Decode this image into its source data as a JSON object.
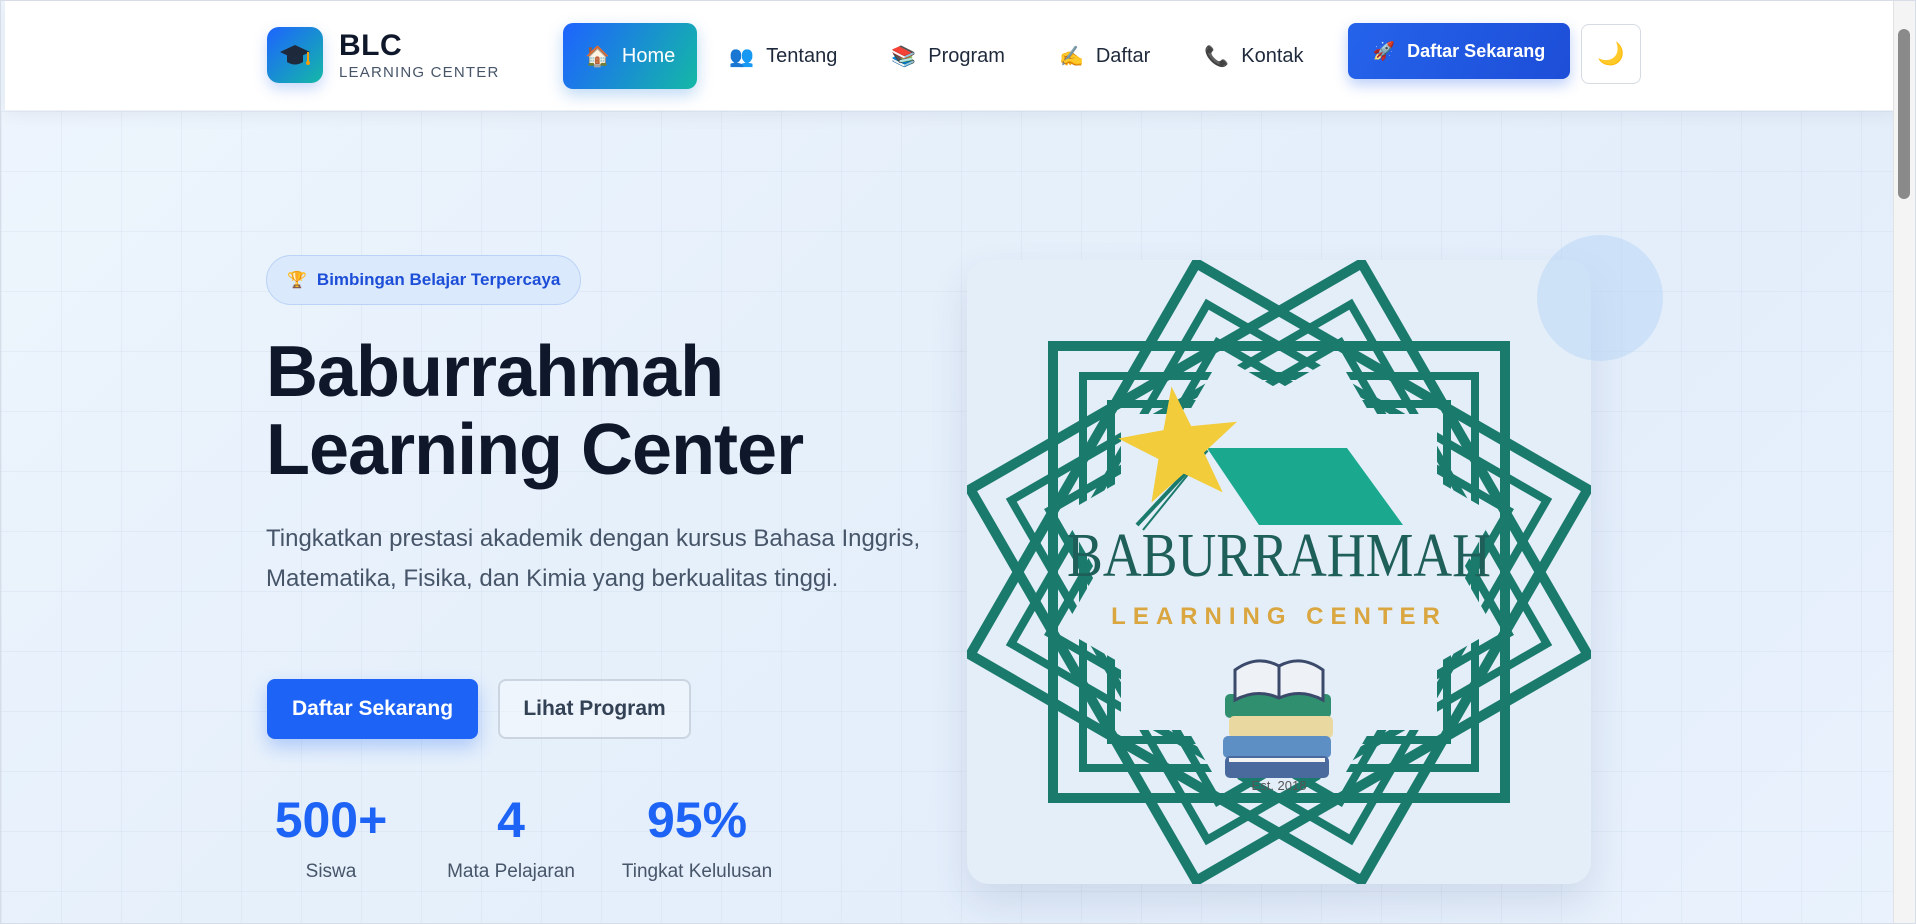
{
  "nav": {
    "brand_title": "BLC",
    "brand_subtitle": "LEARNING CENTER",
    "brand_icon": "graduation-cap-icon",
    "items": [
      {
        "label": "Home",
        "icon": "🏠",
        "icon_name": "house-icon",
        "active": true
      },
      {
        "label": "Tentang",
        "icon": "👥",
        "icon_name": "people-icon",
        "active": false
      },
      {
        "label": "Program",
        "icon": "📚",
        "icon_name": "books-icon",
        "active": false
      },
      {
        "label": "Daftar",
        "icon": "✍️",
        "icon_name": "writing-hand-icon",
        "active": false
      },
      {
        "label": "Kontak",
        "icon": "📞",
        "icon_name": "phone-icon",
        "active": false
      }
    ],
    "cta_label": "Daftar Sekarang",
    "cta_icon": "🚀",
    "theme_icon": "🌙"
  },
  "hero": {
    "badge_icon": "🏆",
    "badge_text": "Bimbingan Belajar Terpercaya",
    "title_line1": "Baburrahmah",
    "title_line2": "Learning Center",
    "description": "Tingkatkan prestasi akademik dengan kursus Bahasa Inggris, Matematika, Fisika, dan Kimia yang berkualitas tinggi.",
    "primary_button": "Daftar Sekarang",
    "secondary_button": "Lihat Program",
    "stats": [
      {
        "value": "500+",
        "label": "Siswa"
      },
      {
        "value": "4",
        "label": "Mata Pelajaran"
      },
      {
        "value": "95%",
        "label": "Tingkat Kelulusan"
      }
    ]
  },
  "logo_card": {
    "logo_name": "BABURRAHMAH",
    "logo_tagline": "LEARNING CENTER",
    "logo_est": "Est. 2018"
  },
  "colors": {
    "primary": "#1d63f5",
    "teal": "#14b8a6",
    "logo_green": "#1a7a6c",
    "logo_gold": "#d9a640"
  }
}
